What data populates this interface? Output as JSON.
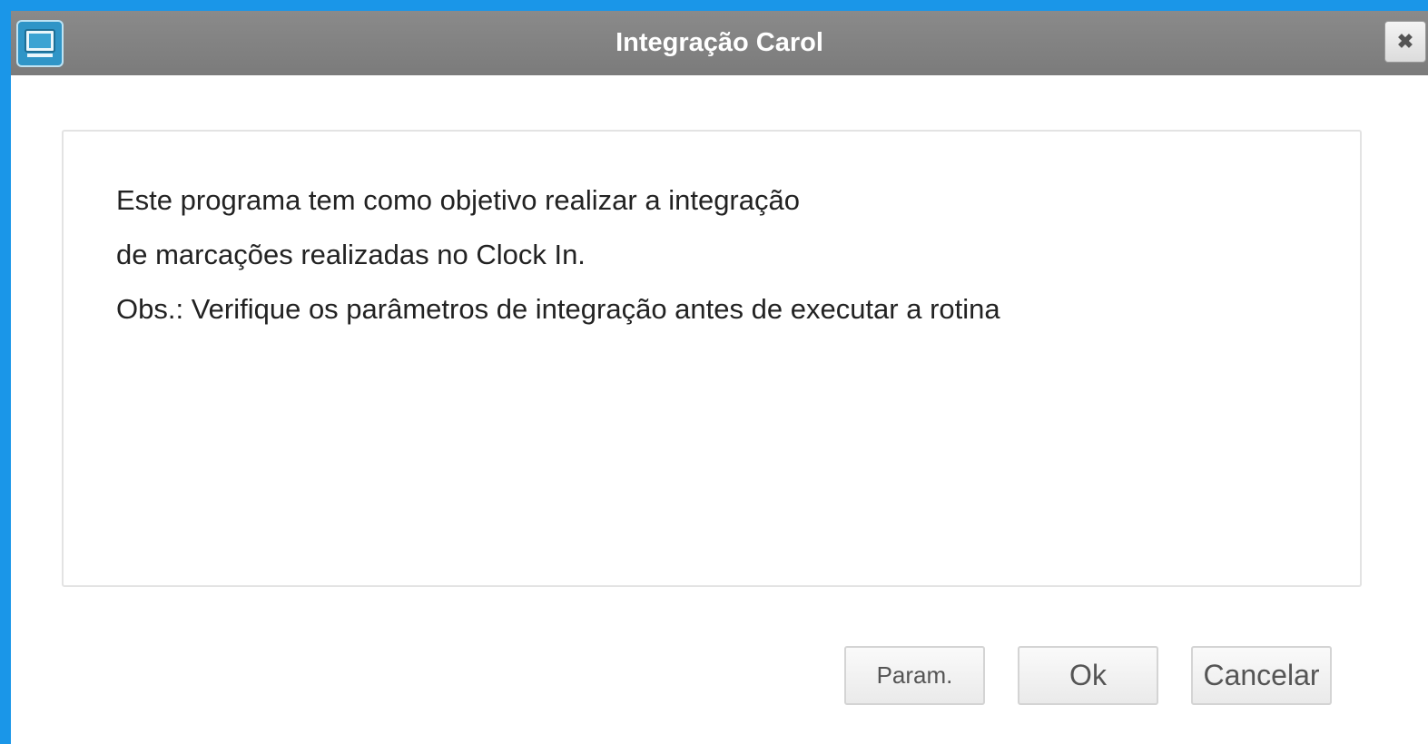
{
  "window": {
    "title": "Integração Carol",
    "icon": "monitor-icon",
    "close_icon": "close-icon",
    "close_label": "✖"
  },
  "message": {
    "line1": "Este programa tem como objetivo realizar a integração",
    "line2": "de marcações realizadas no Clock In.",
    "line3": "Obs.: Verifique os parâmetros de integração antes de executar a rotina"
  },
  "buttons": {
    "param": "Param.",
    "ok": "Ok",
    "cancel": "Cancelar"
  },
  "colors": {
    "background": "#1a96e8",
    "titlebar": "#808080",
    "title_text": "#ffffff"
  }
}
